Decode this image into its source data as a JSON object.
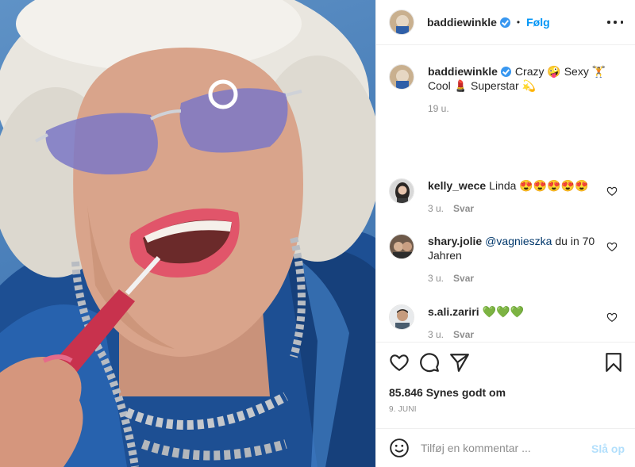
{
  "header": {
    "username": "baddiewinkle",
    "separator": "•",
    "follow_label": "Følg",
    "more_icon": "more-horizontal-icon"
  },
  "caption": {
    "username": "baddiewinkle",
    "text": "Crazy 🤪 Sexy 🏋 Cool 💄 Superstar 💫",
    "time": "19 u."
  },
  "comments": [
    {
      "username": "kelly_wece",
      "text": "Linda 😍😍😍😍😍",
      "time": "3 u.",
      "reply_label": "Svar"
    },
    {
      "username": "shary.jolie",
      "mention": "@vagnieszka",
      "text": " du in 70 Jahren",
      "time": "3 u.",
      "reply_label": "Svar"
    },
    {
      "username": "s.ali.zariri",
      "text": "💚💚💚",
      "time": "3 u.",
      "reply_label": "Svar"
    }
  ],
  "actions": {
    "icons": [
      "heart-icon",
      "comment-icon",
      "share-icon",
      "bookmark-icon"
    ],
    "likes": "85.846 Synes godt om",
    "date": "9. JUNI"
  },
  "add_comment": {
    "placeholder": "Tilføj en kommentar ...",
    "post_label": "Slå op",
    "post_color": "#b2dffc"
  },
  "colors": {
    "accent": "#0095f6",
    "verified": "#3897f0",
    "muted": "#8e8e8e",
    "border": "#efefef"
  }
}
